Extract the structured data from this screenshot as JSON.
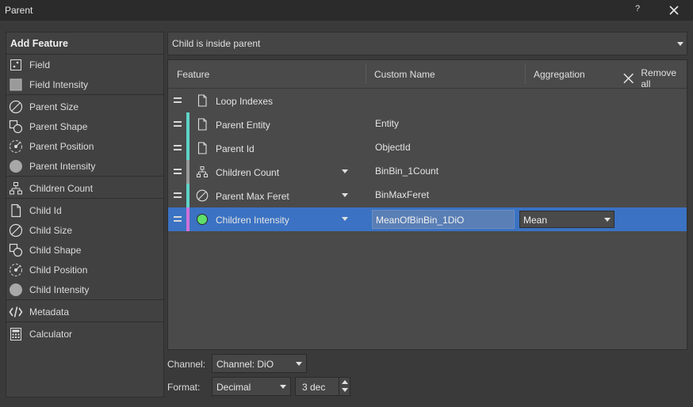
{
  "window": {
    "title": "Parent",
    "help_label": "?"
  },
  "left_panel": {
    "header": "Add Feature",
    "items": [
      {
        "label": "Field",
        "icon": "field-icon"
      },
      {
        "label": "Field Intensity",
        "icon": "field-intensity-icon"
      },
      {
        "label": "Parent Size",
        "icon": "size-icon"
      },
      {
        "label": "Parent Shape",
        "icon": "shape-icon"
      },
      {
        "label": "Parent Position",
        "icon": "position-icon"
      },
      {
        "label": "Parent Intensity",
        "icon": "intensity-icon"
      },
      {
        "label": "Children Count",
        "icon": "hierarchy-icon"
      },
      {
        "label": "Child Id",
        "icon": "document-icon"
      },
      {
        "label": "Child Size",
        "icon": "size-icon"
      },
      {
        "label": "Child Shape",
        "icon": "shape-icon"
      },
      {
        "label": "Child Position",
        "icon": "position-icon"
      },
      {
        "label": "Child Intensity",
        "icon": "intensity-icon"
      },
      {
        "label": "Metadata",
        "icon": "code-icon"
      },
      {
        "label": "Calculator",
        "icon": "calculator-icon"
      }
    ]
  },
  "relation_select": {
    "value": "Child is inside parent"
  },
  "table": {
    "headers": {
      "feature": "Feature",
      "custom_name": "Custom Name",
      "aggregation": "Aggregation"
    },
    "remove_all_label": "Remove all",
    "rows": [
      {
        "feature": "Loop Indexes",
        "custom_name": "",
        "icon": "document-icon",
        "color": "",
        "has_dropdown": false
      },
      {
        "feature": "Parent Entity",
        "custom_name": "Entity",
        "icon": "document-icon",
        "color": "#5fd3c8",
        "has_dropdown": false
      },
      {
        "feature": "Parent Id",
        "custom_name": "ObjectId",
        "icon": "document-icon",
        "color": "#5fd3c8",
        "has_dropdown": false
      },
      {
        "feature": "Children Count",
        "custom_name": "BinBin_1Count",
        "icon": "hierarchy-icon",
        "color": "#9a9a9a",
        "has_dropdown": true
      },
      {
        "feature": "Parent Max Feret",
        "custom_name": "BinMaxFeret",
        "icon": "size-icon",
        "color": "#5fd3c8",
        "has_dropdown": true
      },
      {
        "feature": "Children Intensity",
        "custom_name": "MeanOfBinBin_1DiO",
        "icon": "intensity-icon",
        "color": "#d070d8",
        "has_dropdown": true,
        "aggregation": "Mean",
        "selected": true
      }
    ]
  },
  "bottom": {
    "channel_label": "Channel:",
    "channel_value": "Channel: DiO",
    "format_label": "Format:",
    "format_value": "Decimal",
    "decimals_value": "3 dec"
  },
  "colors": {
    "selection": "#3b72c3",
    "accent_green": "#5ee06a"
  }
}
